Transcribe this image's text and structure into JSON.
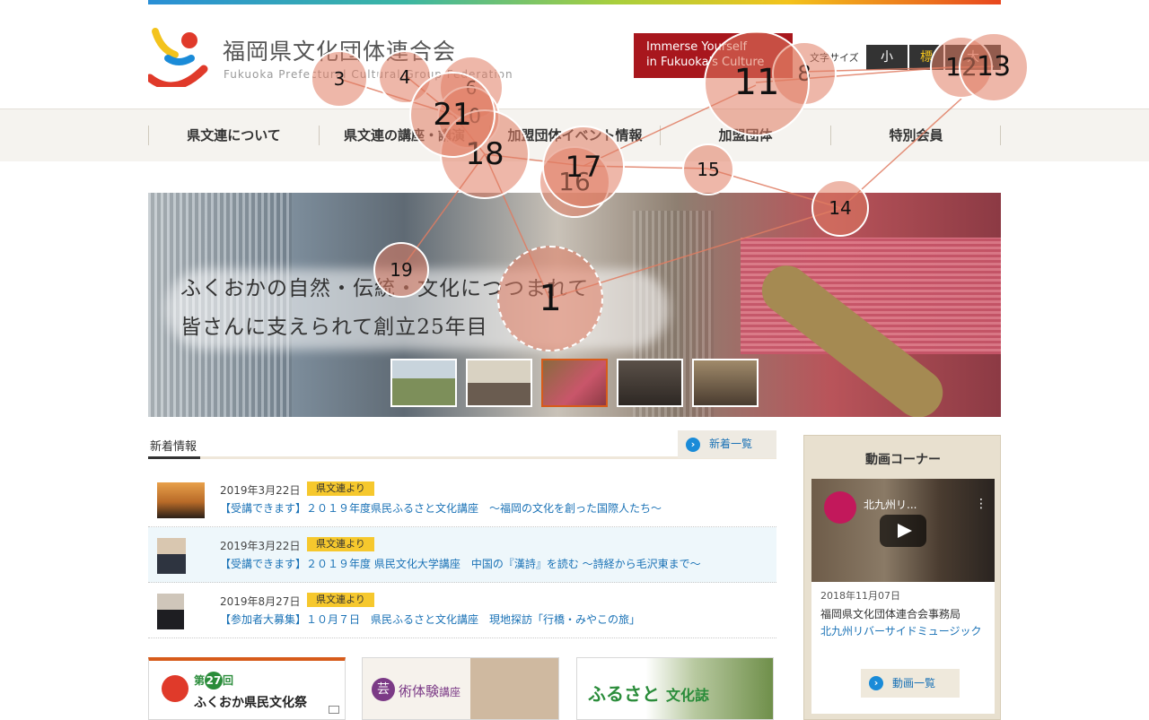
{
  "header": {
    "site_title": "福岡県文化団体連合会",
    "site_subtitle": "Fukuoka Prefectural Cultural Group Federation",
    "immerse_line1": "Immerse Yourself",
    "immerse_line2": "in Fukuoka's Culture",
    "font_size_label": "文字サイズ",
    "font_size_small": "小",
    "font_size_medium": "標",
    "font_size_large": "大"
  },
  "nav": {
    "items": [
      {
        "label": "県文連について"
      },
      {
        "label": "県文連の講座・講演"
      },
      {
        "label": "加盟団体イベント情報"
      },
      {
        "label": "加盟団体"
      },
      {
        "label": "特別会員"
      }
    ]
  },
  "hero": {
    "line1": "ふくおかの自然・伝統・文化につつまれて",
    "line2": "皆さんに支えられて創立25年目"
  },
  "news": {
    "heading": "新着情報",
    "all_label": "新着一覧",
    "items": [
      {
        "date": "2019年3月22日",
        "badge": "県文連より",
        "title": "【受講できます】２０１９年度県民ふるさと文化講座　～福岡の文化を創った国際人たち～"
      },
      {
        "date": "2019年3月22日",
        "badge": "県文連より",
        "title": "【受講できます】２０１９年度 県民文化大学講座　中国の『漢詩』を読む ～詩経から毛沢東まで～"
      },
      {
        "date": "2019年8月27日",
        "badge": "県文連より",
        "title": "【参加者大募集】１０月７日　県民ふるさと文化講座　現地探訪「行橋・みやこの旅」"
      }
    ]
  },
  "banners": {
    "festival_prefix": "第",
    "festival_num": "27",
    "festival_suffix": "回",
    "festival_name": "ふくおか県民文化祭",
    "art_kanji": "芸",
    "art_label": "術体験",
    "art_suffix": "講座",
    "furusato_label": "ふるさと",
    "furusato_suffix": "文化誌"
  },
  "video": {
    "heading": "動画コーナー",
    "overlay_title": "北九州リ...",
    "date": "2018年11月07日",
    "org": "福岡県文化団体連合会事務局",
    "caption": "北九州リバーサイドミュージック",
    "all_label": "動画一覧"
  },
  "markers": [
    "1",
    "3",
    "4",
    "6",
    "8",
    "10",
    "11",
    "12",
    "13",
    "14",
    "15",
    "16",
    "17",
    "18",
    "19",
    "21"
  ],
  "colors": {
    "accent_red": "#a8171d",
    "link_blue": "#1a72b6",
    "badge_yellow": "#f6c82d",
    "marker": "#e07c62"
  }
}
